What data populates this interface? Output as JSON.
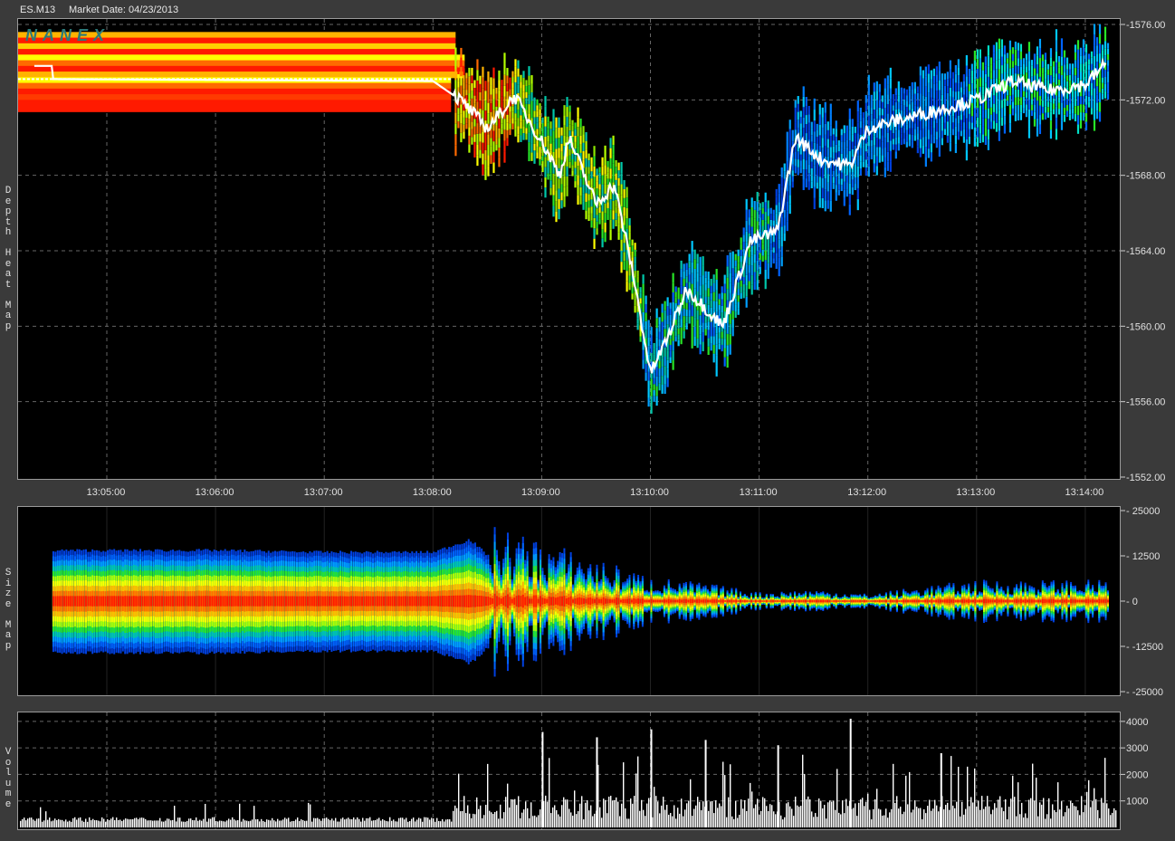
{
  "header": {
    "symbol": "ES.M13",
    "market_date": "Market Date: 04/23/2013",
    "watermark": "NANEX"
  },
  "panels": {
    "depth": {
      "label": "D\ne\np\nt\nh\n\nH\ne\na\nt\n\nM\na\np",
      "y_ticks": [
        "1576.00",
        "1572.00",
        "1568.00",
        "1564.00",
        "1560.00",
        "1556.00",
        "1552.00"
      ]
    },
    "size": {
      "label": "S\ni\nz\ne\n\nM\na\np",
      "y_ticks": [
        "25000",
        "12500",
        "0",
        "-12500",
        "-25000"
      ]
    },
    "volume": {
      "label": "V\no\nl\nu\nm\ne",
      "y_ticks": [
        "4000",
        "3000",
        "2000",
        "1000"
      ]
    }
  },
  "x_ticks": [
    "13:05:00",
    "13:06:00",
    "13:07:00",
    "13:08:00",
    "13:09:00",
    "13:10:00",
    "13:11:00",
    "13:12:00",
    "13:13:00",
    "13:14:00"
  ],
  "colors": {
    "background": "#000000",
    "frame": "#3a3a3a",
    "price_line": "#ffffff",
    "heat": [
      "#ff1a00",
      "#ff6a00",
      "#ffb400",
      "#ffff00",
      "#b4ff00",
      "#28e628",
      "#00c8aa",
      "#00a0ff",
      "#0064ff",
      "#0040e0"
    ]
  },
  "chart_data": [
    {
      "type": "heatmap",
      "title": "Depth Heat Map",
      "ylim": [
        1552,
        1576
      ],
      "x_ticks": [
        "13:05:00",
        "13:06:00",
        "13:07:00",
        "13:08:00",
        "13:09:00",
        "13:10:00",
        "13:11:00",
        "13:12:00",
        "13:13:00",
        "13:14:00"
      ],
      "price_path": [
        [
          "13:04:30",
          1573.1
        ],
        [
          "13:08:00",
          1573.0
        ],
        [
          "13:08:15",
          1572.0
        ],
        [
          "13:08:30",
          1570.5
        ],
        [
          "13:08:45",
          1572.2
        ],
        [
          "13:09:00",
          1569.8
        ],
        [
          "13:09:10",
          1568.0
        ],
        [
          "13:09:15",
          1570.0
        ],
        [
          "13:09:30",
          1566.5
        ],
        [
          "13:09:40",
          1567.5
        ],
        [
          "13:09:50",
          1563.0
        ],
        [
          "13:10:00",
          1557.5
        ],
        [
          "13:10:10",
          1559.5
        ],
        [
          "13:10:20",
          1562.0
        ],
        [
          "13:10:30",
          1561.0
        ],
        [
          "13:10:40",
          1560.0
        ],
        [
          "13:10:55",
          1564.5
        ],
        [
          "13:11:10",
          1565.0
        ],
        [
          "13:11:20",
          1570.0
        ],
        [
          "13:11:35",
          1568.8
        ],
        [
          "13:11:50",
          1568.5
        ],
        [
          "13:12:00",
          1570.5
        ],
        [
          "13:12:20",
          1571.0
        ],
        [
          "13:12:40",
          1571.5
        ],
        [
          "13:13:00",
          1572.0
        ],
        [
          "13:13:20",
          1573.0
        ],
        [
          "13:13:40",
          1572.5
        ],
        [
          "13:14:00",
          1572.8
        ],
        [
          "13:14:10",
          1573.8
        ]
      ]
    },
    {
      "type": "area",
      "title": "Size Map",
      "ylim": [
        -25000,
        25000
      ],
      "envelope": [
        [
          "13:04:30",
          14000
        ],
        [
          "13:06:00",
          14000
        ],
        [
          "13:07:00",
          13500
        ],
        [
          "13:08:00",
          13500
        ],
        [
          "13:08:20",
          17000
        ],
        [
          "13:08:30",
          12500
        ],
        [
          "13:09:00",
          10000
        ],
        [
          "13:09:30",
          7000
        ],
        [
          "13:10:00",
          4000
        ],
        [
          "13:10:30",
          3000
        ],
        [
          "13:11:00",
          1500
        ],
        [
          "13:11:30",
          2000
        ],
        [
          "13:12:00",
          1200
        ],
        [
          "13:12:30",
          2500
        ],
        [
          "13:13:00",
          3500
        ],
        [
          "13:13:30",
          3500
        ],
        [
          "13:14:00",
          3500
        ],
        [
          "13:14:10",
          3500
        ]
      ]
    },
    {
      "type": "bar",
      "title": "Volume",
      "ylim": [
        0,
        4200
      ],
      "before_1308": 300,
      "after_1308_range": [
        300,
        2800
      ],
      "peaks": [
        [
          "13:09:00",
          3600
        ],
        [
          "13:09:30",
          3400
        ],
        [
          "13:10:00",
          3700
        ],
        [
          "13:10:30",
          3300
        ],
        [
          "13:11:10",
          3100
        ],
        [
          "13:11:50",
          4100
        ],
        [
          "13:12:40",
          2800
        ]
      ]
    }
  ]
}
